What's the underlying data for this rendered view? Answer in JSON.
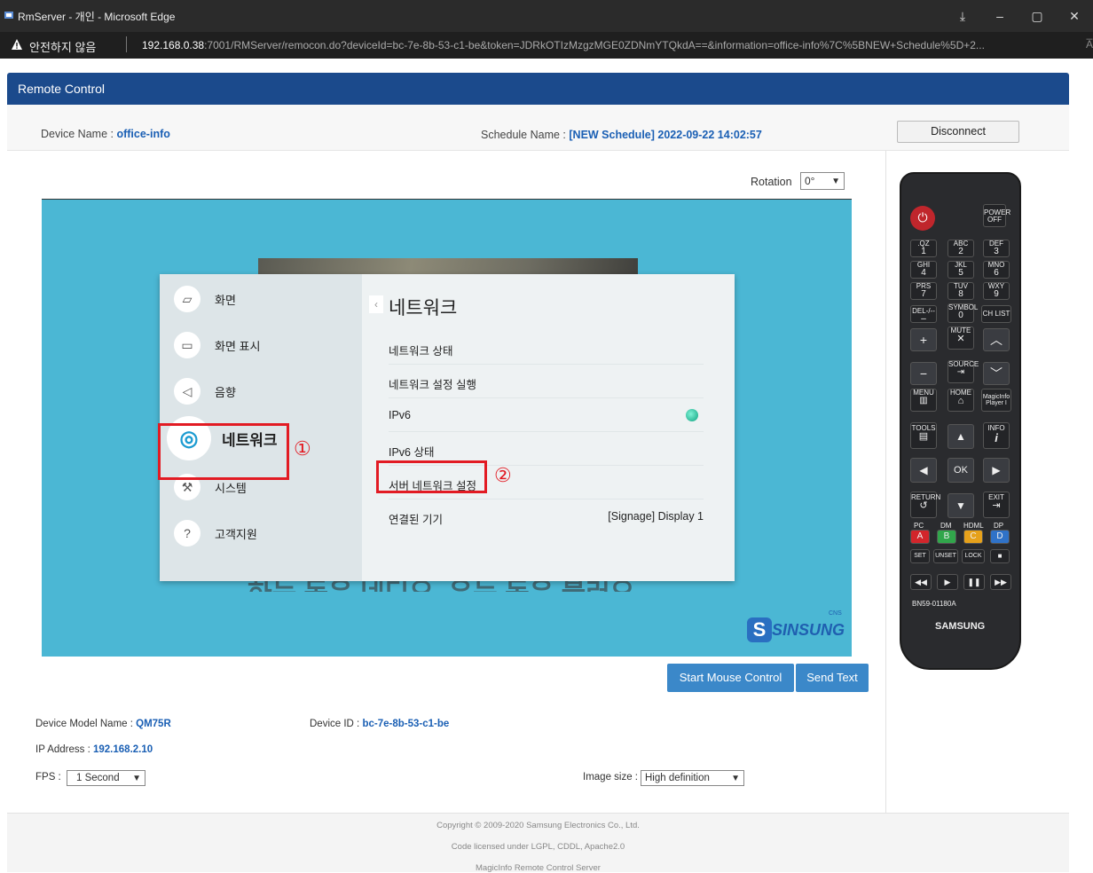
{
  "browser": {
    "title": "RmServer - 개인 - Microsoft Edge",
    "warn_text": "안전하지 않음",
    "url_host": "192.168.0.38",
    "url_rest": ":7001/RMServer/remocon.do?deviceId=bc-7e-8b-53-c1-be&token=JDRkOTIzMzgzMGE0ZDNmYTQkdA==&information=office-info%7C%5BNEW+Schedule%5D+2...",
    "reader": "A̅"
  },
  "header": {
    "title": "Remote Control"
  },
  "info": {
    "device_name_label": "Device Name :",
    "device_name": "office-info",
    "schedule_label": "Schedule Name :",
    "schedule_name": "[NEW Schedule] 2022-09-22 14:02:57",
    "disconnect": "Disconnect"
  },
  "rotation": {
    "label": "Rotation",
    "value": "0°"
  },
  "tv_menu": {
    "left_items": [
      "화면",
      "화면 표시",
      "음향",
      "네트워크",
      "시스템",
      "고객지원"
    ],
    "heading": "네트워크",
    "rows": [
      {
        "label": "네트워크 상태",
        "value": ""
      },
      {
        "label": "네트워크 설정 실행",
        "value": ""
      },
      {
        "label": "IPv6",
        "value": ""
      },
      {
        "label": "IPv6 상태",
        "value": ""
      },
      {
        "label": "서버 네트워크 설정",
        "value": ""
      },
      {
        "label": "연결된 기기",
        "value": "[Signage] Display 1"
      }
    ],
    "annotation_1": "①",
    "annotation_2": "②",
    "bg_text": "하는 독은 네디오, 우는 독은 불러오."
  },
  "logo": {
    "text": "SINSUNG",
    "sub": "CNS"
  },
  "buttons": {
    "start_mouse": "Start Mouse Control",
    "send_text": "Send Text"
  },
  "meta": {
    "model_label": "Device Model Name :",
    "model": "QM75R",
    "device_id_label": "Device ID :",
    "device_id": "bc-7e-8b-53-c1-be",
    "ip_label": "IP Address :",
    "ip": "192.168.2.10",
    "fps_label": "FPS :",
    "fps": "1 Second",
    "image_size_label": "Image size :",
    "image_size": "High definition"
  },
  "footer": {
    "copyright": "Copyright © 2009-2020 Samsung Electronics Co., Ltd.",
    "license": "Code licensed under LGPL, CDDL, Apache2.0",
    "product": "MagicInfo Remote Control Server"
  },
  "remote": {
    "power_off": "POWER OFF",
    "keys": [
      [
        ".QZ",
        "1"
      ],
      [
        "ABC",
        "2"
      ],
      [
        "DEF",
        "3"
      ],
      [
        "GHI",
        "4"
      ],
      [
        "JKL",
        "5"
      ],
      [
        "MNO",
        "6"
      ],
      [
        "PRS",
        "7"
      ],
      [
        "TUV",
        "8"
      ],
      [
        "WXY",
        "9"
      ]
    ],
    "del": "DEL-/--",
    "symbol": "SYMBOL",
    "zero": "0",
    "ch_list": "CH LIST",
    "mute": "MUTE",
    "source": "SOURCE",
    "menu": "MENU",
    "home": "HOME",
    "magicinfo": "MagicInfo Player I",
    "tools": "TOOLS",
    "info": "INFO",
    "ok": "OK",
    "return": "RETURN",
    "exit": "EXIT",
    "pc": "PC",
    "dm": "DM",
    "hdmi": "HDML",
    "dp": "DP",
    "a": "A",
    "b": "B",
    "c": "C",
    "d": "D",
    "set": "SET",
    "unset": "UNSET",
    "lock": "LOCK",
    "model": "BN59-01180A",
    "brand": "SAMSUNG"
  }
}
